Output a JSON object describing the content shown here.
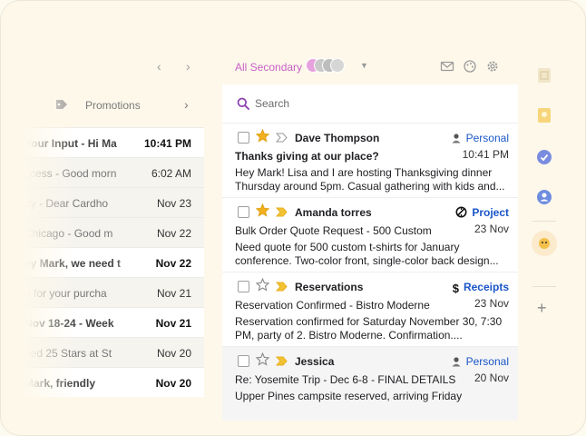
{
  "left_panel": {
    "prev_arrow": "‹",
    "next_arrow": "›",
    "category_label": "Promotions",
    "category_chevron": "›",
    "rows": [
      {
        "snippet": "Your Input - Hi Ma",
        "time": "10:41 PM",
        "bold": true,
        "white": true
      },
      {
        "snippet": "ccess - Good morn",
        "time": "6:02 AM",
        "bold": false,
        "white": false
      },
      {
        "snippet": "dy - Dear Cardho",
        "time": "Nov 23",
        "bold": false,
        "white": false
      },
      {
        "snippet": "Chicago - Good m",
        "time": "Nov 22",
        "bold": false,
        "white": false
      },
      {
        "snippet": "ey Mark, we need t",
        "time": "Nov 22",
        "bold": true,
        "white": true
      },
      {
        "snippet": "u for your purcha",
        "time": "Nov 21",
        "bold": false,
        "white": false
      },
      {
        "snippet": "Nov 18-24 - Week",
        "time": "Nov 21",
        "bold": true,
        "white": true
      },
      {
        "snippet": "ned 25 Stars at St",
        "time": "Nov 20",
        "bold": false,
        "white": false
      },
      {
        "snippet": "Mark, friendly",
        "time": "Nov 20",
        "bold": true,
        "white": true
      }
    ]
  },
  "header": {
    "inbox_label": "All Secondary",
    "caret": "▼",
    "colors": {
      "accent": "#c95fc8"
    }
  },
  "search": {
    "placeholder": "Search"
  },
  "emails": [
    {
      "sender": "Dave Thompson",
      "starred": true,
      "important": false,
      "label": "Personal",
      "label_icon": "person-icon",
      "label_bold": false,
      "time": "10:41 PM",
      "subject": "Thanks giving at our place?",
      "subject_bold": true,
      "snippet": "Hey Mark! Lisa and I are hosting Thanksgiving dinner Thursday around 5pm. Casual gathering with kids and...",
      "grey": false
    },
    {
      "sender": "Amanda torres",
      "starred": true,
      "important": true,
      "label": "Project",
      "label_icon": "project-icon",
      "label_bold": true,
      "time": "23 Nov",
      "subject": "Bulk Order Quote Request - 500 Custom",
      "subject_bold": false,
      "snippet": "Need quote for 500 custom t-shirts for January conference. Two-color front, single-color back design...",
      "grey": false
    },
    {
      "sender": "Reservations",
      "starred": false,
      "important": true,
      "label": "Receipts",
      "label_icon": "dollar-icon",
      "label_bold": true,
      "time": "23 Nov",
      "subject": "Reservation Confirmed - Bistro Moderne",
      "subject_bold": false,
      "snippet": "Reservation confirmed for Saturday November 30, 7:30 PM, party of 2. Bistro Moderne. Confirmation....",
      "grey": false
    },
    {
      "sender": "Jessica",
      "starred": false,
      "important": true,
      "label": "Personal",
      "label_icon": "person-icon",
      "label_bold": false,
      "time": "20 Nov",
      "subject": "Re: Yosemite Trip - Dec 6-8 - FINAL DETAILS",
      "subject_bold": false,
      "snippet": "Upper Pines campsite reserved, arriving Friday",
      "grey": true
    }
  ],
  "rail": {
    "add_label": "+",
    "icons": [
      "sheets-icon",
      "keep-icon",
      "tasks-icon",
      "contacts-icon",
      "extension-icon"
    ]
  }
}
